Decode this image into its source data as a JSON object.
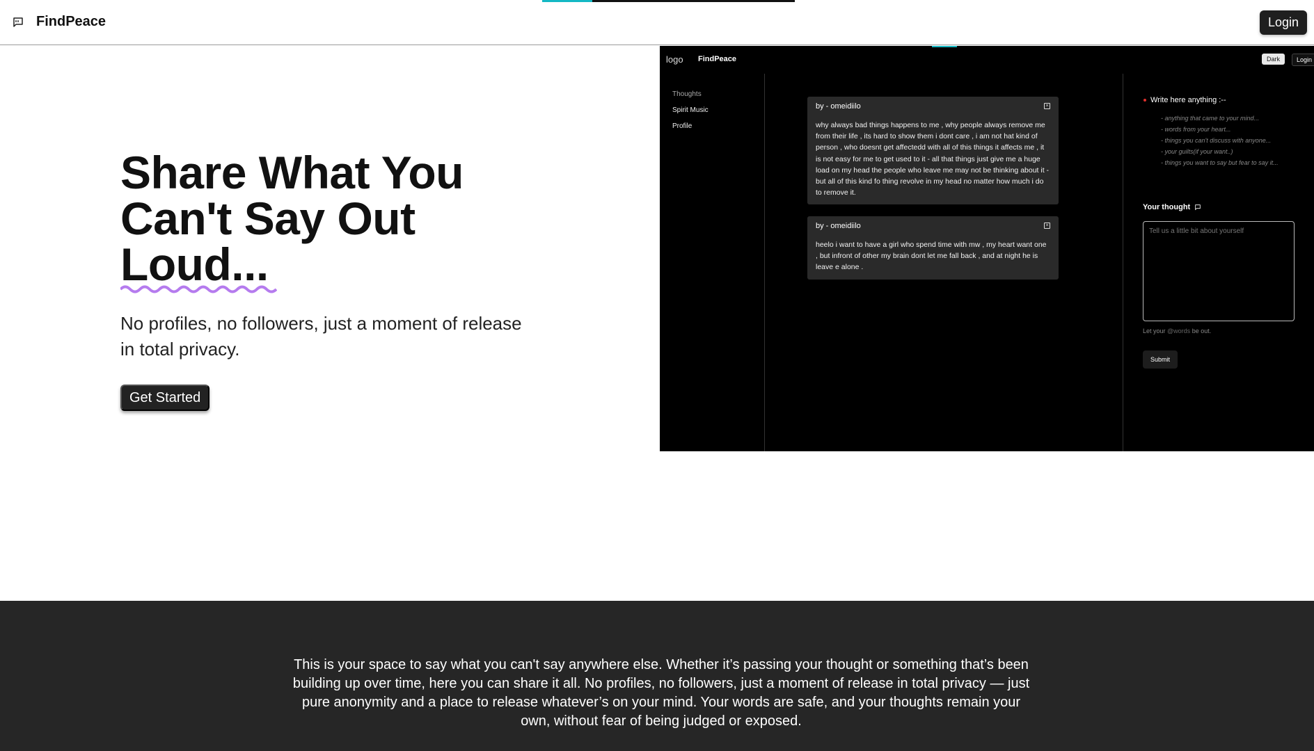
{
  "header": {
    "brand": "FindPeace",
    "brand_icon": "message-square-icon",
    "login_label": "Login",
    "scroll_progress": 0.2
  },
  "hero": {
    "title_line1": "Share What You",
    "title_line2": "Can't Say Out",
    "title_line3": "Loud...",
    "subtitle": "No profiles, no followers, just a moment of release in total privacy.",
    "cta_label": "Get Started",
    "underline_color": "#b57bee"
  },
  "preview": {
    "logo_alt": "logo",
    "brand": "FindPeace",
    "dark_label": "Dark",
    "login_label": "Login",
    "nav": [
      "Thoughts",
      "Spirit Music",
      "Profile"
    ],
    "cards": [
      {
        "by": "by - omeidiilo",
        "text": "why always bad things happens to me , why people always remove me from their life , its hard to show them i dont care , i am not hat kind of person , who doesnt get affectedd with all of this things it affects me , it is not easy for me to get used to it - all that things just give me a huge load on my head the people who leave me may not be thinking about it - but all of this kind fo thing revolve in my head no matter how much i do to remove it."
      },
      {
        "by": "by - omeidiilo",
        "text": "heelo i want to have a girl who spend time with mw , my heart want one , but infront of other my brain dont let me fall back , and at night he is leave e alone ."
      }
    ],
    "write_heading": "Write here anything :--",
    "hints": [
      "- anything that came to your mind...",
      "- words from your heart...",
      "- things you can't discuss with anyone...",
      "- your guilts(if your want..)",
      "- things you want to say but fear to say it..."
    ],
    "your_thought_label": "Your thought",
    "textarea_placeholder": "Tell us a little bit about yourself",
    "helper_prefix": "Let your ",
    "helper_at": "@words",
    "helper_suffix": " be out.",
    "submit_label": "Submit"
  },
  "about": {
    "text": "This is your space to say what you can't say anywhere else. Whether it’s passing your thought or something that’s been building up over time, here you can share it all. No profiles, no followers, just a moment of release in total privacy — just pure anonymity and a place to release whatever’s on your mind. Your words are safe, and your thoughts remain your own, without fear of being judged or exposed."
  }
}
